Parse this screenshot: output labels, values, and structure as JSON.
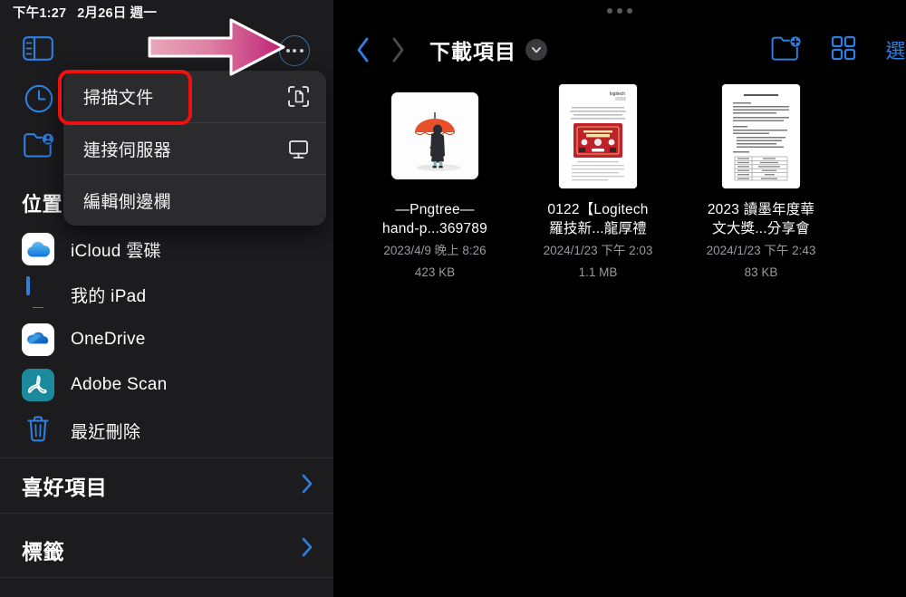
{
  "statusbar": {
    "time": "下午1:27",
    "date": "2月26日 週一"
  },
  "sidebar": {
    "icons": [
      {
        "name": "sidebar-toggle-icon",
        "label": "側邊欄"
      },
      {
        "name": "recents-clock-icon",
        "label": "最近項目"
      },
      {
        "name": "shared-folder-icon",
        "label": "共享"
      }
    ],
    "more_button": "more-ellipsis-button",
    "location_header": "位置",
    "places": [
      {
        "label": "iCloud 雲碟",
        "icon": "icloud-icon"
      },
      {
        "label": "我的 iPad",
        "icon": "ipad-icon"
      },
      {
        "label": "OneDrive",
        "icon": "onedrive-icon"
      },
      {
        "label": "Adobe Scan",
        "icon": "adobe-scan-icon"
      },
      {
        "label": "最近刪除",
        "icon": "trash-icon"
      }
    ],
    "groups": [
      {
        "label": "喜好項目",
        "chevron": "chevron-right-icon"
      },
      {
        "label": "標籤",
        "chevron": "chevron-right-icon"
      }
    ]
  },
  "context_menu": {
    "items": [
      {
        "label": "掃描文件",
        "icon": "document-scan-icon",
        "highlighted": true
      },
      {
        "label": "連接伺服器",
        "icon": "monitor-server-icon",
        "highlighted": false
      },
      {
        "label": "編輯側邊欄",
        "icon": "",
        "highlighted": false
      }
    ]
  },
  "annotation": {
    "highlight_color": "#ee1111",
    "arrow_from": "#e8a0b4",
    "arrow_to": "#c4267e"
  },
  "main": {
    "nav_back": "chevron-left-icon",
    "nav_forward": "chevron-right-icon",
    "folder_title": "下載項目",
    "title_chevron": "chevron-down-icon",
    "actions": [
      {
        "name": "new-folder-icon",
        "label": "新增檔案夾"
      },
      {
        "name": "grid-view-icon",
        "label": "顯示方式"
      }
    ],
    "select_label": "選",
    "files": [
      {
        "name": "—Pngtree—\nhand-p...369789",
        "name_line1": "—Pngtree—",
        "name_line2": "hand-p...369789",
        "date": "2023/4/9 晚上 8:26",
        "size": "423 KB",
        "thumb": "umbrella-illustration"
      },
      {
        "name": "0122【Logitech\n羅技新...龍厚禮",
        "name_line1": "0122【Logitech",
        "name_line2": "羅技新...龍厚禮",
        "date": "2024/1/23 下午 2:03",
        "size": "1.1 MB",
        "thumb": "logitech-document"
      },
      {
        "name": "2023 讀墨年度華\n文大獎...分享會",
        "name_line1": "2023 讀墨年度華",
        "name_line2": "文大獎...分享會",
        "date": "2024/1/23 下午 2:43",
        "size": "83 KB",
        "thumb": "text-document"
      }
    ]
  }
}
